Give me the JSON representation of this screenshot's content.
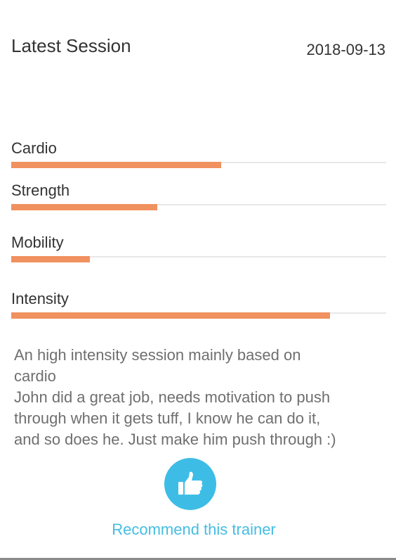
{
  "session": {
    "title": "Latest Session",
    "date": "2018-09-13"
  },
  "metrics": [
    {
      "label": "Cardio",
      "value": 0.56
    },
    {
      "label": "Strength",
      "value": 0.39
    },
    {
      "label": "Mobility",
      "value": 0.21
    },
    {
      "label": "Intensity",
      "value": 0.85
    }
  ],
  "notes": {
    "line1": "An high intensity session mainly based on",
    "line2": "cardio",
    "line3": "John did a great job, needs motivation to push",
    "line4": "through when it gets tuff, I know he can do it,",
    "line5": "and so does he. Just make him push through :)"
  },
  "recommend": {
    "icon": "thumbs-up-icon",
    "label": "Recommend this trainer",
    "accent_color": "#3dbde6"
  },
  "colors": {
    "bar_fill": "#f0915f",
    "bar_track": "#e8e8e8"
  }
}
